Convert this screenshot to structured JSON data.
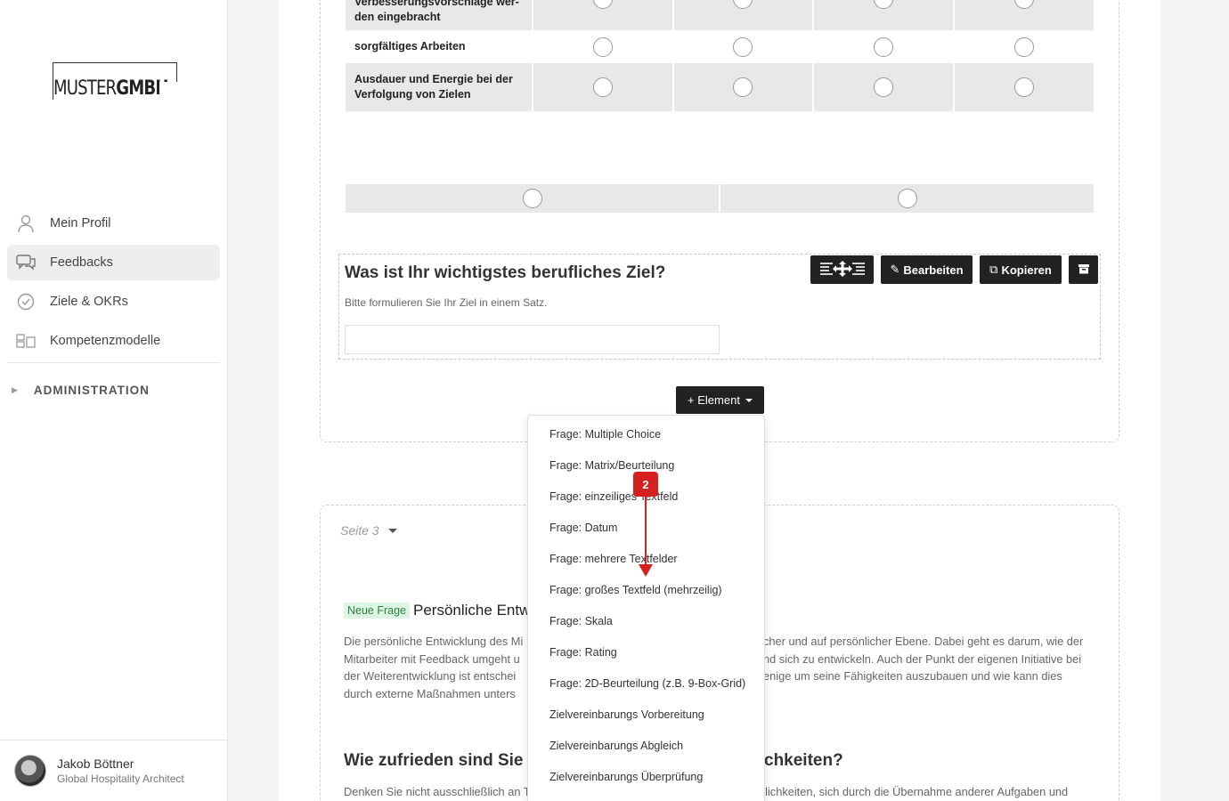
{
  "logo": {
    "part1": "MUSTER",
    "part2": "GMBH"
  },
  "nav": [
    {
      "label": "Mein Profil",
      "icon": "user-icon"
    },
    {
      "label": "Feedbacks",
      "icon": "chat-icon",
      "active": true
    },
    {
      "label": "Ziele & OKRs",
      "icon": "check-circle-icon"
    },
    {
      "label": "Kompetenzmodelle",
      "icon": "grid-icon"
    }
  ],
  "admin_label": "ADMINISTRATION",
  "user": {
    "name": "Jakob Böttner",
    "role": "Global Hospitality Architect"
  },
  "matrix": {
    "rows": [
      "Verbesserungsvorschläge wer- den eingebracht",
      "sorgfältiges Arbeiten",
      "Ausdauer und Energie bei der Verfolgung von Zielen"
    ]
  },
  "question": {
    "title": "Was ist Ihr wichtigstes berufliches Ziel?",
    "hint": "Bitte formulieren Sie Ihr Ziel in einem Satz."
  },
  "toolbar": {
    "edit": "Bearbeiten",
    "copy": "Kopieren"
  },
  "element_button": "+ Element",
  "menu": [
    "Frage: Multiple Choice",
    "Frage: Matrix/Beurteilung",
    "Frage: einzeiliges Textfeld",
    "Frage: Datum",
    "Frage: mehrere Textfelder",
    "Frage: großes Textfeld (mehrzeilig)",
    "Frage: Skala",
    "Frage: Rating",
    "Frage: 2D-Beurteilung (z.B. 9-Box-Grid)",
    "Zielvereinbarungs Vorbereitung",
    "Zielvereinbarungs Abgleich",
    "Zielvereinbarungs Überprüfung"
  ],
  "page3": {
    "label": "Seite 3",
    "badge": "Neue Frage",
    "title": "Persönliche Entw",
    "desc_left": "Die persönliche Entwicklung des Mi Mitarbeiter mit Feedback umgeht u der Weiterentwicklung ist entschei durch externe Maßnahmen unters",
    "desc_right": "cher und auf persönlicher Ebene. Dabei geht es darum, wie der nd sich zu entwickeln. Auch der Punkt der eigenen Initiative bei enige um seine Fähigkeiten auszubauen und wie kann dies",
    "q2_left": "Wie zufrieden sind Sie",
    "q2_right": "chkeiten?",
    "desc2_left": "Denken Sie nicht ausschließlich an Tr",
    "desc2_right": "glichkeiten, sich durch die Übernahme anderer Aufgaben und"
  },
  "annotation": {
    "step": "2",
    "color": "#d62020"
  }
}
